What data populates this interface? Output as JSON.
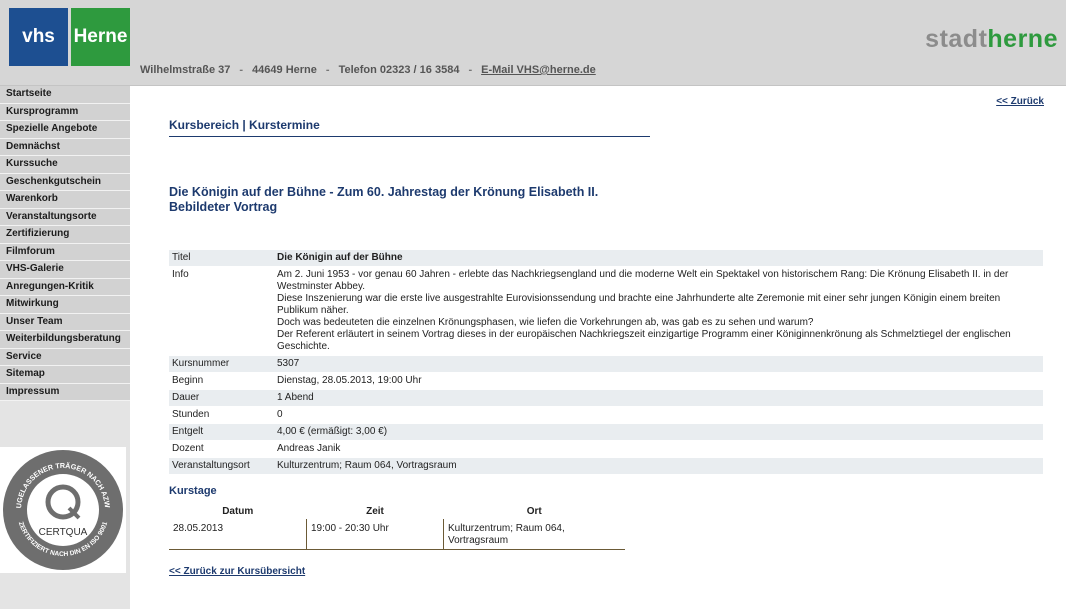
{
  "header": {
    "logo_vhs": "vhs",
    "logo_herne": "Herne",
    "brand_part1": "stadt",
    "brand_part2": "herne",
    "street": "Wilhelmstraße 37",
    "city": "44649 Herne",
    "phone": "Telefon 02323 / 16 3584",
    "email": "E-Mail VHS@herne.de",
    "separator": "-"
  },
  "nav": [
    "Startseite",
    "Kursprogramm",
    "Spezielle Angebote",
    "Demnächst",
    "Kurssuche",
    "Geschenkgutschein",
    "Warenkorb",
    "Veranstaltungsorte",
    "Zertifizierung",
    "Filmforum",
    "VHS-Galerie",
    "Anregungen-Kritik",
    "Mitwirkung",
    "Unser Team",
    "Weiterbildungsberatung",
    "Service",
    "Sitemap",
    "Impressum"
  ],
  "certqua": {
    "name": "CERTQUA",
    "ring_top": "ZUGELASSENER TRÄGER NACH AZWV",
    "ring_bottom": "ZERTIFIZIERT NACH DIN EN ISO 9001"
  },
  "main": {
    "back_top": "<< Zurück",
    "section_title": "Kursbereich | Kurstermine",
    "course_title_1": "Die Königin auf der Bühne - Zum 60. Jahrestag der Krönung Elisabeth II.",
    "course_title_2": "Bebildeter Vortrag",
    "details": {
      "titel_label": "Titel",
      "titel_value": "Die Königin auf der Bühne",
      "info_label": "Info",
      "info_p1": "Am 2. Juni 1953 - vor genau 60 Jahren - erlebte das Nachkriegsengland und die moderne Welt ein Spektakel von historischem Rang: Die Krönung Elisabeth II. in der Westminster Abbey.",
      "info_p2": "Diese Inszenierung war die erste live ausgestrahlte Eurovisionssendung und brachte eine Jahrhunderte alte Zeremonie mit einer sehr jungen Königin einem breiten Publikum näher.",
      "info_p3": "Doch was bedeuteten die einzelnen Krönungsphasen, wie liefen die Vorkehrungen ab, was gab es zu sehen und warum?",
      "info_p4": "Der Referent erläutert in seinem Vortrag dieses in der europäischen Nachkriegszeit einzigartige Programm einer Königinnenkrönung als Schmelztiegel der englischen Geschichte.",
      "kursnummer_label": "Kursnummer",
      "kursnummer_value": "5307",
      "beginn_label": "Beginn",
      "beginn_value": "Dienstag, 28.05.2013, 19:00 Uhr",
      "dauer_label": "Dauer",
      "dauer_value": "1 Abend",
      "stunden_label": "Stunden",
      "stunden_value": "0",
      "entgelt_label": "Entgelt",
      "entgelt_value": "4,00 € (ermäßigt: 3,00 €)",
      "dozent_label": "Dozent",
      "dozent_value": "Andreas Janik",
      "ort_label": "Veranstaltungsort",
      "ort_value": "Kulturzentrum; Raum 064, Vortragsraum"
    },
    "kurstage": {
      "title": "Kurstage",
      "col_datum": "Datum",
      "col_zeit": "Zeit",
      "col_ort": "Ort",
      "row_datum": "28.05.2013",
      "row_zeit": "19:00 - 20:30 Uhr",
      "row_ort_1": "Kulturzentrum; Raum 064,",
      "row_ort_2": "Vortragsraum"
    },
    "back_bottom": "<< Zurück zur Kursübersicht"
  }
}
